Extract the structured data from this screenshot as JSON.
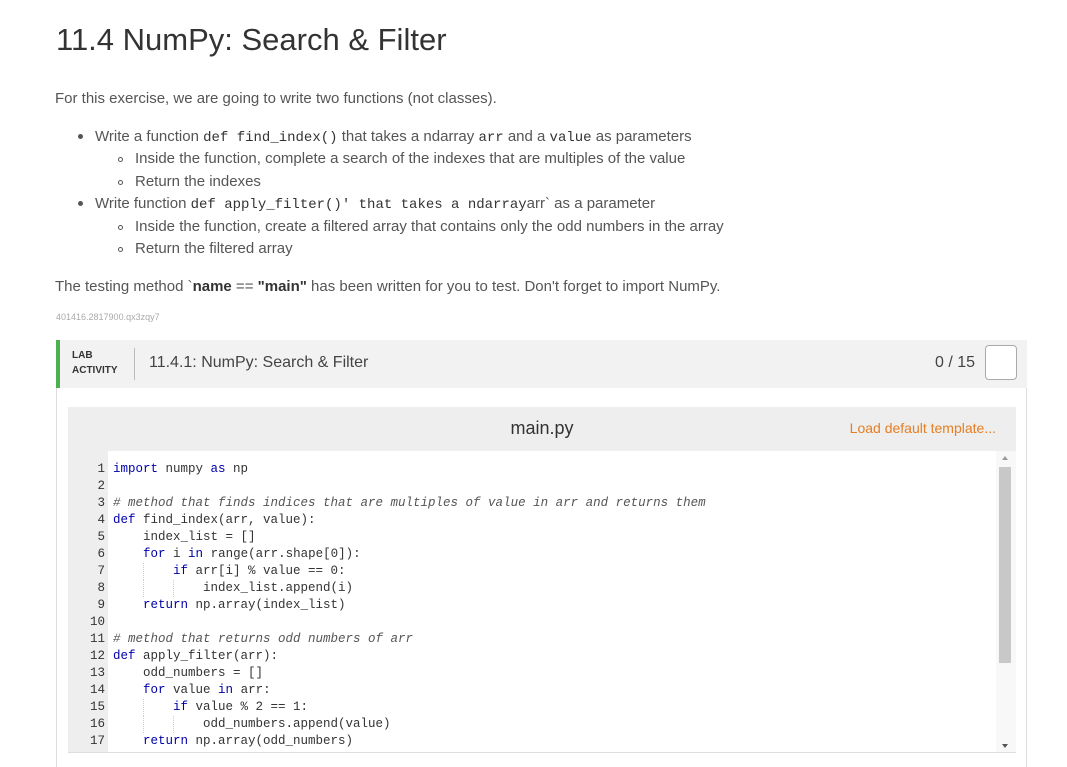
{
  "page": {
    "title": "11.4 NumPy: Search & Filter",
    "intro": "For this exercise, we are going to write two functions (not classes).",
    "bullets": {
      "b1": {
        "pre": "Write a function ",
        "code1": "def find_index()",
        "mid": " that takes a ndarray ",
        "code2": "arr",
        "mid2": " and a ",
        "code3": "value",
        "post": " as parameters"
      },
      "b1_sub1": "Inside the function, complete a search of the indexes that are multiples of the value",
      "b1_sub2": "Return the indexes",
      "b2": {
        "pre": "Write function ",
        "code": "def apply_filter()' that takes a ndarray",
        "mid": "arr",
        "post": "` as a parameter"
      },
      "b2_sub1": "Inside the function, create a filtered array that contains only the odd numbers in the array",
      "b2_sub2": "Return the filtered array"
    },
    "testing": {
      "pre": "The testing method `",
      "bold1": "name",
      "mid": " == ",
      "bold2": "\"main\"",
      "post": " has been written for you to test. Don't forget to import NumPy."
    },
    "tiny_id": "401416.2817900.qx3zqy7"
  },
  "lab": {
    "tag_line1": "LAB",
    "tag_line2": "ACTIVITY",
    "title": "11.4.1: NumPy: Search & Filter",
    "score": "0 / 15",
    "accent": "#4caf50"
  },
  "editor": {
    "filename": "main.py",
    "load_template": "Load default template...",
    "lines": [
      "import numpy as np",
      "",
      "# method that finds indices that are multiples of value in arr and returns them",
      "def find_index(arr, value):",
      "    index_list = []",
      "    for i in range(arr.shape[0]):",
      "        if arr[i] % value == 0:",
      "            index_list.append(i)",
      "    return np.array(index_list)",
      "",
      "# method that returns odd numbers of arr",
      "def apply_filter(arr):",
      "    odd_numbers = []",
      "    for value in arr:",
      "        if value % 2 == 1:",
      "            odd_numbers.append(value)",
      "    return np.array(odd_numbers)"
    ]
  }
}
